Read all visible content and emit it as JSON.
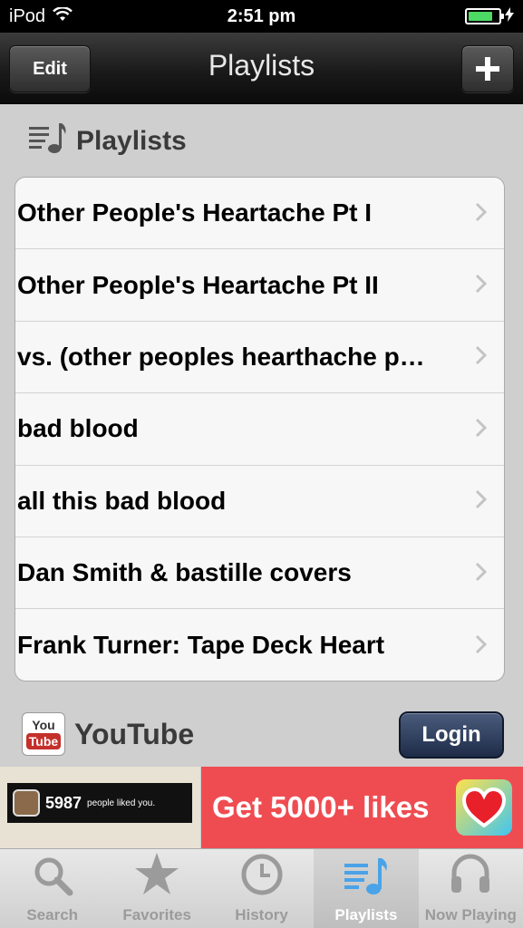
{
  "status": {
    "carrier": "iPod",
    "time": "2:51 pm",
    "battery_level": 0.8
  },
  "nav": {
    "edit_label": "Edit",
    "title": "Playlists",
    "add_label": "+"
  },
  "playlists_section": {
    "title": "Playlists",
    "icon": "playlist-icon",
    "items": [
      {
        "label": "Other People's Heartache Pt I"
      },
      {
        "label": "Other People's Heartache Pt II"
      },
      {
        "label": "vs. (other peoples hearthache p…"
      },
      {
        "label": "bad blood"
      },
      {
        "label": "all this bad blood"
      },
      {
        "label": "Dan Smith & bastille covers"
      },
      {
        "label": "Frank Turner: Tape Deck Heart"
      }
    ]
  },
  "youtube_section": {
    "title": "YouTube",
    "icon_you": "You",
    "icon_tube": "Tube",
    "login_label": "Login"
  },
  "ad": {
    "count": "5987",
    "small_text": "people liked you.",
    "headline": "Get 5000+ likes"
  },
  "tabs": [
    {
      "label": "Search",
      "icon": "search-icon",
      "active": false
    },
    {
      "label": "Favorites",
      "icon": "star-icon",
      "active": false
    },
    {
      "label": "History",
      "icon": "clock-icon",
      "active": false
    },
    {
      "label": "Playlists",
      "icon": "playlist-icon",
      "active": true
    },
    {
      "label": "Now Playing",
      "icon": "headphones-icon",
      "active": false
    }
  ],
  "colors": {
    "accent_tab": "#4aa3e8",
    "ad_red": "#ef4c51",
    "login_blue": "#1e2c48",
    "battery_green": "#4cd964"
  }
}
